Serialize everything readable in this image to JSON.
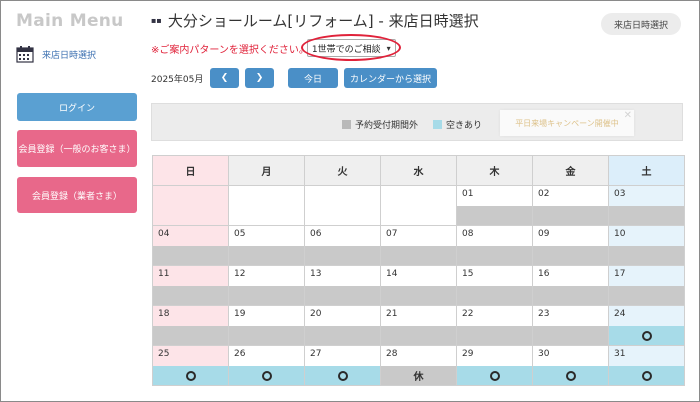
{
  "sidebar": {
    "title": "Main Menu",
    "nav_label": "来店日時選択",
    "login_label": "ログイン",
    "register_general_label": "会員登録（一般のお客さま）",
    "register_business_label": "会員登録（業者さま）"
  },
  "header": {
    "title": "大分ショールーム[リフォーム] - 来店日時選択",
    "badge": "来店日時選択",
    "pattern_label": "※ご案内パターンを選択ください。",
    "pattern_selected": "1世帯でのご相談"
  },
  "nav": {
    "month": "2025年05月",
    "prev": "<",
    "next": ">",
    "today": "今日",
    "pick_from_calendar": "カレンダーから選択"
  },
  "legend": {
    "out_of_period": "予約受付期間外",
    "available": "空きあり",
    "campaign_text": "平日来場キャンペーン開催中"
  },
  "colors": {
    "unavailable": "#c9c9c9",
    "available": "#a7dbe8",
    "accent": "#4a8fc7",
    "pink": "#e8688a"
  },
  "calendar": {
    "weekdays": [
      "日",
      "月",
      "火",
      "水",
      "木",
      "金",
      "土"
    ],
    "weeks": [
      [
        {
          "day": "",
          "status": "none"
        },
        {
          "day": "",
          "status": "none"
        },
        {
          "day": "",
          "status": "none"
        },
        {
          "day": "",
          "status": "none"
        },
        {
          "day": "01",
          "status": "unavailable"
        },
        {
          "day": "02",
          "status": "unavailable"
        },
        {
          "day": "03",
          "status": "unavailable"
        }
      ],
      [
        {
          "day": "04",
          "status": "unavailable"
        },
        {
          "day": "05",
          "status": "unavailable"
        },
        {
          "day": "06",
          "status": "unavailable"
        },
        {
          "day": "07",
          "status": "unavailable"
        },
        {
          "day": "08",
          "status": "unavailable"
        },
        {
          "day": "09",
          "status": "unavailable"
        },
        {
          "day": "10",
          "status": "unavailable"
        }
      ],
      [
        {
          "day": "11",
          "status": "unavailable"
        },
        {
          "day": "12",
          "status": "unavailable"
        },
        {
          "day": "13",
          "status": "unavailable"
        },
        {
          "day": "14",
          "status": "unavailable"
        },
        {
          "day": "15",
          "status": "unavailable"
        },
        {
          "day": "16",
          "status": "unavailable"
        },
        {
          "day": "17",
          "status": "unavailable"
        }
      ],
      [
        {
          "day": "18",
          "status": "unavailable"
        },
        {
          "day": "19",
          "status": "unavailable"
        },
        {
          "day": "20",
          "status": "unavailable"
        },
        {
          "day": "21",
          "status": "unavailable"
        },
        {
          "day": "22",
          "status": "unavailable"
        },
        {
          "day": "23",
          "status": "unavailable"
        },
        {
          "day": "24",
          "status": "available"
        }
      ],
      [
        {
          "day": "25",
          "status": "available"
        },
        {
          "day": "26",
          "status": "available"
        },
        {
          "day": "27",
          "status": "available"
        },
        {
          "day": "28",
          "status": "closed",
          "label": "休"
        },
        {
          "day": "29",
          "status": "available"
        },
        {
          "day": "30",
          "status": "available"
        },
        {
          "day": "31",
          "status": "available"
        }
      ]
    ]
  }
}
